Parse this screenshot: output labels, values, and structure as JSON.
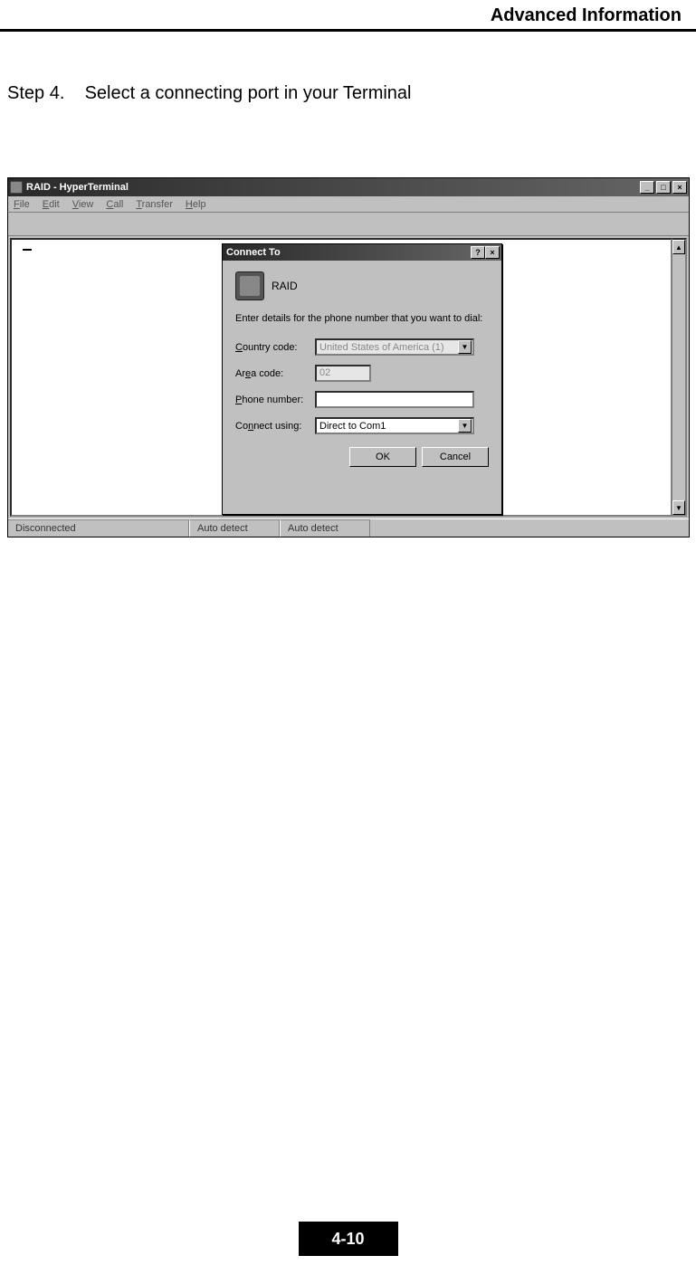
{
  "page": {
    "header": "Advanced Information",
    "step_label": "Step 4.",
    "step_text": "Select a connecting port in your Terminal",
    "page_number": "4-10"
  },
  "hyperterminal": {
    "title": "RAID - HyperTerminal",
    "menu": {
      "file": "File",
      "edit": "Edit",
      "view": "View",
      "call": "Call",
      "transfer": "Transfer",
      "help": "Help"
    },
    "status": {
      "conn": "Disconnected",
      "detect1": "Auto detect",
      "detect2": "Auto detect"
    }
  },
  "dialog": {
    "title": "Connect To",
    "name": "RAID",
    "instruction": "Enter details for the phone number that you want to dial:",
    "labels": {
      "country": "Country code:",
      "area": "Area code:",
      "phone": "Phone number:",
      "connect": "Connect using:"
    },
    "values": {
      "country": "United States of America (1)",
      "area": "02",
      "phone": "",
      "connect": "Direct to Com1"
    },
    "buttons": {
      "ok": "OK",
      "cancel": "Cancel"
    }
  }
}
